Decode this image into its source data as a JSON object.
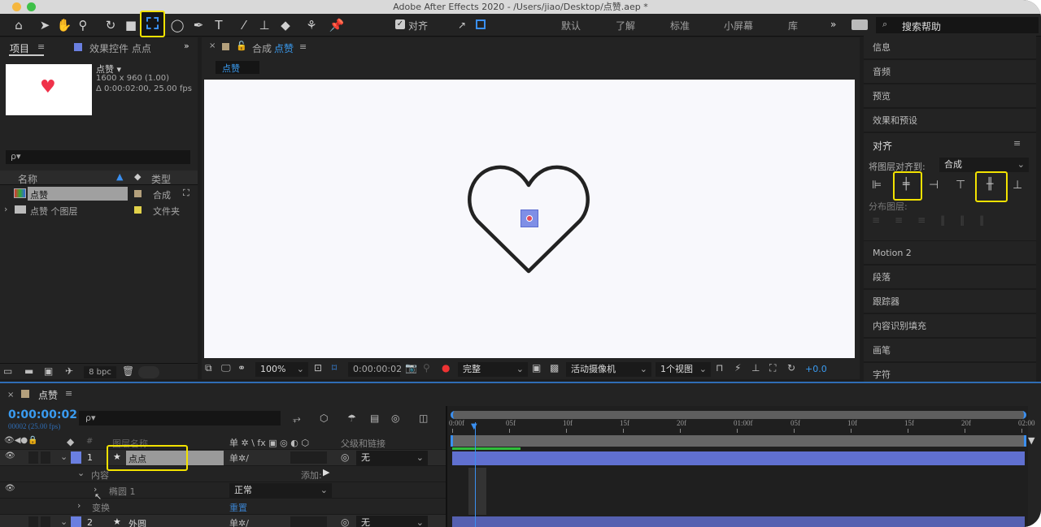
{
  "window": {
    "title": "Adobe After Effects 2020 - /Users/jiao/Desktop/点赞.aep *"
  },
  "toolbar": {
    "tools": [
      "home-icon",
      "selection-icon",
      "hand-icon",
      "zoom-icon",
      "rotate-icon",
      "camera-icon",
      "anchor-point-icon",
      "ellipse-icon",
      "pen-icon",
      "type-icon",
      "brush-icon",
      "clone-stamp-icon",
      "eraser-icon",
      "roto-brush-icon",
      "puppet-pin-icon"
    ],
    "align_checkbox": "对齐",
    "align_checked": true,
    "workspaces": [
      "默认",
      "了解",
      "标准",
      "小屏幕",
      "库"
    ],
    "more": "»",
    "search_help": "搜索帮助",
    "highlight_color": "#f2e200"
  },
  "project_panel": {
    "tab_project": "项目",
    "tab_effects": "效果控件 点点",
    "comp_name": "点赞 ▾",
    "comp_size": "1600 x 960 (1.00)",
    "comp_duration": "Δ 0:00:02:00, 25.00 fps",
    "search_placeholder": "ρ▾",
    "col_name": "名称",
    "col_type": "类型",
    "items": [
      {
        "name": "点赞",
        "type": "合成",
        "label_color": "#b4a07c"
      },
      {
        "name": "点赞 个图层",
        "type": "文件夹",
        "label_color": "#e2d24a"
      }
    ],
    "bpc": "8 bpc"
  },
  "comp_panel": {
    "tab_label": "合成",
    "tab_comp": "点赞",
    "breadcrumb": "点赞",
    "zoom": "100%",
    "timecode": "0:00:00:02",
    "resolution": "完整",
    "camera": "活动摄像机",
    "views": "1个视图",
    "exposure": "+0.0"
  },
  "right_panel": {
    "items_top": [
      "信息",
      "音频",
      "预览",
      "效果和预设"
    ],
    "align": {
      "title": "对齐",
      "align_to_label": "将图层对齐到:",
      "align_to_value": "合成",
      "distribute_label": "分布图层:"
    },
    "items_bottom": [
      "Motion 2",
      "段落",
      "跟踪器",
      "内容识别填充",
      "画笔",
      "字符"
    ]
  },
  "timeline": {
    "comp_tab": "点赞",
    "timecode": "0:00:00:02",
    "frame_info": "00002 (25.00 fps)",
    "search_placeholder": "ρ▾",
    "col_num": "#",
    "col_layer_name": "图层名称",
    "col_switches": "单 ✲ \\ fx ▣ ◎ ◐ ⬡",
    "col_parent": "父级和链接",
    "ruler": [
      "0:00f",
      "05f",
      "10f",
      "15f",
      "20f",
      "01:00f",
      "05f",
      "10f",
      "15f",
      "20f",
      "02:00"
    ],
    "playhead_frame": 2,
    "work_area_frames": 50,
    "layers": [
      {
        "num": "1",
        "name": "点点",
        "parent": "无",
        "color": "#6a7fe0"
      },
      {
        "num": "2",
        "name": "外圆",
        "parent": "无",
        "color": "#6a7fe0"
      }
    ],
    "contents_label": "内容",
    "add_label": "添加:",
    "ellipse_label": "椭圆 1",
    "blend_mode": "正常",
    "transform_label": "变换",
    "reset_label": "重置"
  }
}
